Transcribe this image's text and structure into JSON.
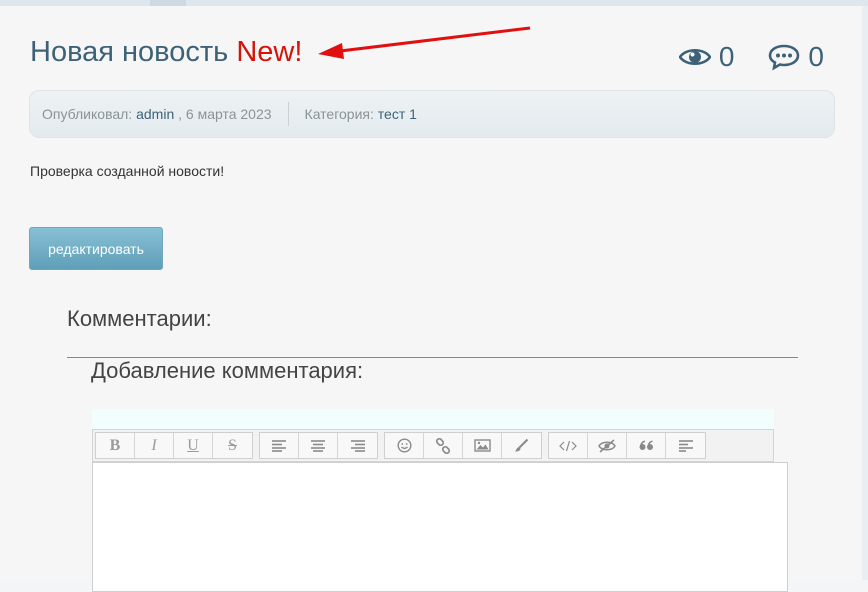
{
  "news": {
    "title": "Новая новость",
    "badge": "New!",
    "views": "0",
    "comments": "0",
    "body": "Проверка созданной новости!"
  },
  "meta": {
    "published_label": "Опубликовал:",
    "author": "admin",
    "date": ", 6 марта 2023",
    "category_label": "Категория:",
    "category": "тест 1"
  },
  "actions": {
    "edit_label": "редактировать"
  },
  "comments": {
    "heading": "Комментарии:",
    "add_heading": "Добавление комментария:"
  },
  "toolbar": {
    "groups": [
      [
        "bold-icon",
        "italic-icon",
        "underline-icon",
        "strikethrough-icon"
      ],
      [
        "align-left-icon",
        "align-center-icon",
        "align-right-icon"
      ],
      [
        "smiley-icon",
        "link-icon",
        "image-icon",
        "brush-icon"
      ],
      [
        "code-icon",
        "hide-icon",
        "quote-icon",
        "paragraph-icon"
      ]
    ],
    "bold": "B",
    "italic": "I",
    "underline": "U",
    "strike": "S"
  },
  "colors": {
    "title": "#3d6278",
    "badge": "#d4140a",
    "arrow": "#e01010"
  }
}
